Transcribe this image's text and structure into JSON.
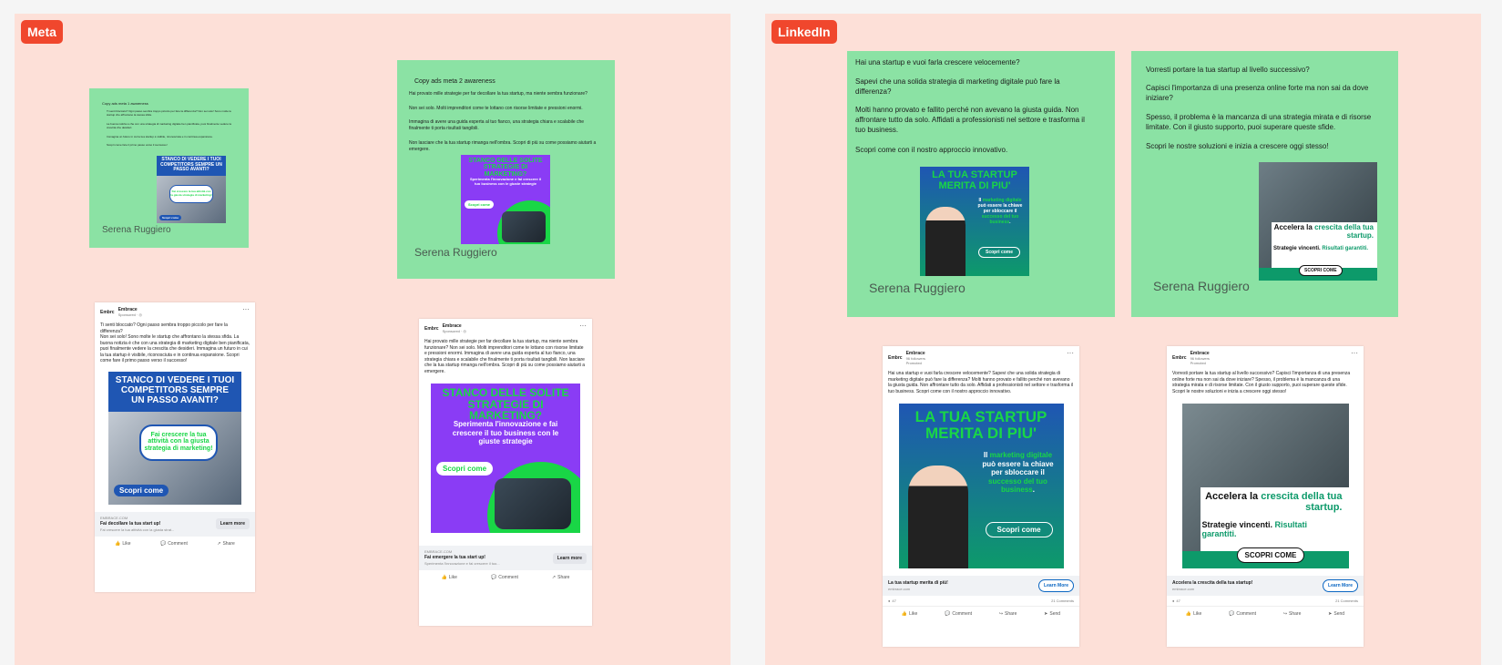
{
  "sections": {
    "meta": {
      "label": "Meta"
    },
    "linkedin": {
      "label": "LinkedIn"
    }
  },
  "meta_notes": {
    "note1": {
      "title": "Copy ads meta 1 awareness",
      "paragraphs": [
        "Ti senti bloccato? Ogni passo sembra troppo piccolo per fare la differenza? Non sei solo! Sono molte le startup che affrontano la stessa sfida.",
        "La buona notizia è che con una strategia di marketing digitale ben pianificata, puoi finalmente vedere la crescita che desideri.",
        "Immagina un futuro in cui la tua startup è visibile, riconosciuta e in continua espansione.",
        "Scopri come fare il primo passo verso il successo!"
      ],
      "author": "Serena Ruggiero"
    },
    "note2": {
      "title": "Copy ads meta 2 awareness",
      "paragraphs": [
        "Hai provato mille strategie per far decollare la tua startup, ma niente sembra funzionare?",
        "Non sei solo. Molti imprenditori come te lottano con risorse limitate e pressioni enormi.",
        "Immagina di avere una guida esperta al tuo fianco, una strategia chiara e scalabile che finalmente ti porta risultati tangibili.",
        "Non lasciare che la tua startup rimanga nell'ombra. Scopri di più su come possiamo aiutarti a emergere."
      ],
      "author": "Serena Ruggiero"
    }
  },
  "linkedin_notes": {
    "note1": {
      "paragraphs": [
        "Hai una startup e vuoi farla crescere velocemente?",
        "Sapevi che una solida strategia di marketing digitale può fare la differenza?",
        "Molti hanno provato e fallito perché non avevano la giusta guida. Non affrontare tutto da solo. Affidati a professionisti nel settore e trasforma il tuo business.",
        "Scopri come con il nostro approccio innovativo."
      ],
      "author": "Serena Ruggiero"
    },
    "note2": {
      "paragraphs": [
        "Vorresti portare la tua startup al livello successivo?",
        "Capisci l'importanza di una presenza online forte ma non sai da dove iniziare?",
        "Spesso, il problema è la mancanza di una strategia mirata e di risorse limitate. Con il giusto supporto, puoi superare queste sfide.",
        "Scopri le nostre soluzioni e inizia a crescere oggi stesso!"
      ],
      "author": "Serena Ruggiero"
    }
  },
  "creatives": {
    "c1": {
      "headline": "STANCO DI VEDERE I TUOI COMPETITORS SEMPRE UN PASSO AVANTI?",
      "bubble": "Fai crescere la tua attività con la giusta strategia di marketing!",
      "cta": "Scopri come"
    },
    "c2": {
      "headline": "STANCO DELLE SOLITE STRATEGIE DI MARKETING?",
      "sub": "Sperimenta l'innovazione e fai crescere il tuo business con le giuste strategie",
      "cta": "Scopri come"
    },
    "c3": {
      "headline": "LA TUA STARTUP MERITA DI PIU'",
      "body_prefix": "Il ",
      "body_hl1": "marketing digitale",
      "body_mid": " può essere la chiave per sbloccare il ",
      "body_hl2": "successo del tuo business",
      "body_suffix": ".",
      "cta": "Scopri come"
    },
    "c4": {
      "headline_a": "Accelera la ",
      "headline_hl": "crescita",
      "headline_b": " della tua startup.",
      "sub_a": "Strategie vincenti. ",
      "sub_hl": "Risultati garantiti.",
      "cta": "SCOPRI COME"
    }
  },
  "posts": {
    "fb1": {
      "logo": "Embrc",
      "brand": "Embrace",
      "sub": "Sponsored · ◎",
      "copy": "Ti senti bloccato? Ogni passo sembra troppo piccolo per fare la differenza?\nNon sei solo! Sono molte le startup che affrontano la stessa sfida. La buona notizia è che con una strategia di marketing digitale ben pianificata, puoi finalmente vedere la crescita che desideri. Immagina un futuro in cui la tua startup è visibile, riconosciuta e in continua espansione. Scopri come fare il primo passo verso il successo!",
      "url": "EMBRACE.COM",
      "link_title": "Fai decollare la tua start up!",
      "link_desc": "Fai crescere la tua attività con la giusta strat...",
      "cta": "Learn more",
      "actions": [
        "Like",
        "Comment",
        "Share"
      ]
    },
    "fb2": {
      "logo": "Embrc",
      "brand": "Embrace",
      "sub": "Sponsored · ◎",
      "copy": "Hai provato mille strategie per far decollare la tua startup, ma niente sembra funzionare? Non sei solo. Molti imprenditori come te lottano con risorse limitate e pressioni enormi. Immagina di avere una guida esperta al tuo fianco, una strategia chiara e scalabile che finalmente ti porta risultati tangibili. Non lasciare che la tua startup rimanga nell'ombra. Scopri di più su come possiamo aiutarti a emergere.",
      "url": "EMBRACE.COM",
      "link_title": "Fai emergere la tua start up!",
      "link_desc": "Sperimenta l'innovazione e fai crescere il tuo...",
      "cta": "Learn more",
      "actions": [
        "Like",
        "Comment",
        "Share"
      ]
    },
    "li1": {
      "logo": "Embrc",
      "brand": "Embrace",
      "followers": "96 followers",
      "promoted": "Promoted",
      "copy": "Hai una startup e vuoi farla crescere velocemente? Sapevi che una solida strategia di marketing digitale può fare la differenza? Molti hanno provato e fallito perché non avevano la giusta guida. Non affrontare tutto da solo. Affidati a professionisti nel settore e trasforma il tuo business. Scopri come con il nostro approccio innovativo.",
      "link_title": "La tua startup merita di più!",
      "url": "embrace.com",
      "cta": "Learn More",
      "reactions": "47",
      "comments": "21 Comments",
      "actions": [
        "Like",
        "Comment",
        "Share",
        "Send"
      ]
    },
    "li2": {
      "logo": "Embrc",
      "brand": "Embrace",
      "followers": "96 followers",
      "promoted": "Promoted",
      "copy": "Vorresti portare la tua startup al livello successivo? Capisci l'importanza di una presenza online forte ma non sai da dove iniziare? Spesso, il problema è la mancanza di una strategia mirata e di risorse limitate. Con il giusto supporto, puoi superare queste sfide. Scopri le nostre soluzioni e inizia a crescere oggi stesso!",
      "link_title": "Accelera la crescita della tua startup!",
      "url": "embrace.com",
      "cta": "Learn More",
      "reactions": "47",
      "comments": "21 Comments",
      "actions": [
        "Like",
        "Comment",
        "Share",
        "Send"
      ]
    }
  },
  "colors": {
    "section_bg": "#fde0d8",
    "tag_bg": "#f0472d",
    "note_bg": "#8be2a4",
    "creative_blue": "#1f56b3",
    "creative_purple": "#8a3cf5",
    "creative_green": "#19d646",
    "creative_teal": "#0d9a6a"
  }
}
